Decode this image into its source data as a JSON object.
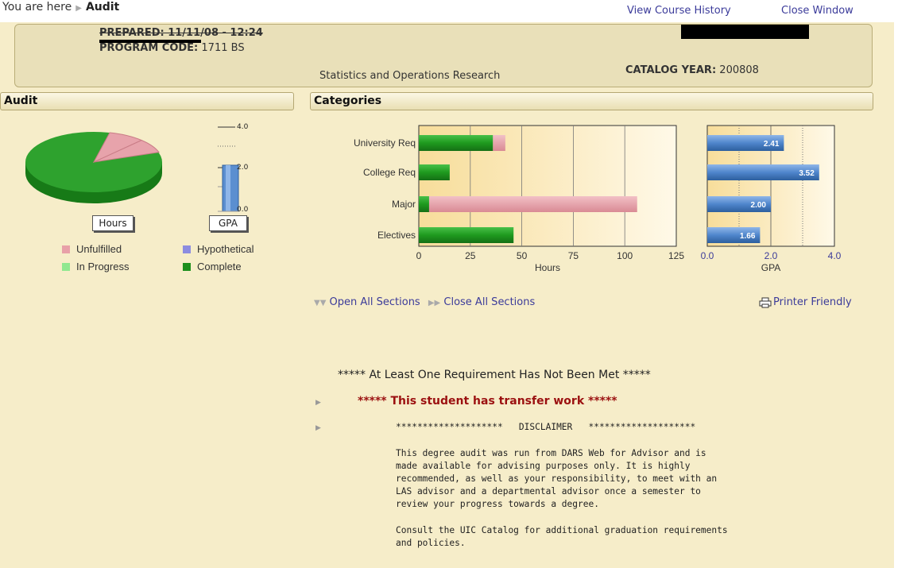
{
  "breadcrumb": {
    "prefix": "You are here",
    "current": "Audit"
  },
  "top_links": {
    "history": "View Course History",
    "close": "Close Window"
  },
  "header": {
    "prepared": "PREPARED: 11/11/08 - 12:24",
    "program_code_label": "PROGRAM CODE:",
    "program_code": "1711 BS",
    "program_name": "Statistics and Operations Research",
    "catalog_label": "CATALOG YEAR:",
    "catalog_year": "200808"
  },
  "sections": {
    "audit": "Audit",
    "categories": "Categories"
  },
  "audit_panel": {
    "hours_button": "Hours",
    "gpa_button": "GPA",
    "gpa_ticks": [
      "4.0",
      "2.0",
      "0.0"
    ],
    "legend": [
      {
        "label": "Unfulfilled",
        "color": "#e8a0a8"
      },
      {
        "label": "Hypothetical",
        "color": "#8c8ce0"
      },
      {
        "label": "In Progress",
        "color": "#90e890"
      },
      {
        "label": "Complete",
        "color": "#1d8f1d"
      }
    ]
  },
  "chart_data": [
    {
      "type": "bar",
      "categories": [
        "University Req",
        "College Req",
        "Major",
        "Electives"
      ],
      "series": [
        {
          "name": "Complete",
          "values": [
            36,
            15,
            5,
            46
          ]
        },
        {
          "name": "Unfulfilled",
          "values": [
            6,
            0,
            101,
            0
          ]
        }
      ],
      "xlabel": "Hours",
      "xlim": [
        0,
        125
      ],
      "ticks": [
        "0",
        "25",
        "50",
        "75",
        "100",
        "125"
      ]
    },
    {
      "type": "bar",
      "categories": [
        "University Req",
        "College Req",
        "Major",
        "Electives"
      ],
      "values": [
        2.41,
        3.52,
        2.0,
        1.66
      ],
      "labels": [
        "2.41",
        "3.52",
        "2.00",
        "1.66"
      ],
      "xlabel": "GPA",
      "xlim": [
        0,
        4
      ],
      "ticks": [
        "0.0",
        "2.0",
        "4.0"
      ]
    }
  ],
  "actions": {
    "open_all": "Open All Sections",
    "close_all": "Close All Sections",
    "printer": "Printer Friendly"
  },
  "messages": {
    "not_met": "***** At Least One Requirement Has Not Been Met *****",
    "transfer": "***** This student has transfer work *****",
    "disclaimer_header": "********************   DISCLAIMER   ********************",
    "disclaimer_body": "This degree audit was run from DARS Web for Advisor and is\nmade available for advising purposes only. It is highly\nrecommended, as well as your responsibility, to meet with an\nLAS advisor and a departmental advisor once a semester to\nreview your progress towards a degree.",
    "consult": "Consult the UIC Catalog for additional graduation requirements\nand policies."
  }
}
